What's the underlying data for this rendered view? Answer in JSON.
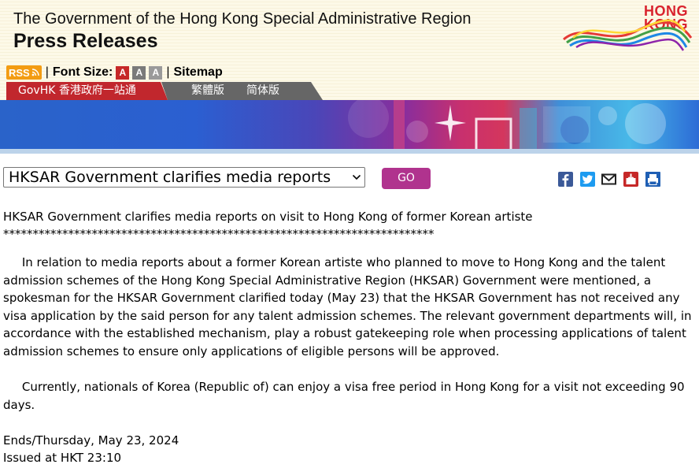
{
  "header": {
    "gov_title": "The Government of the Hong Kong Special Administrative Region",
    "section_title": "Press Releases",
    "brand": {
      "line1": "HONG",
      "line2": "KONG"
    }
  },
  "toolbar": {
    "rss_label": "RSS",
    "separator": "|",
    "font_size_label": "Font Size:",
    "font_sizes": [
      "A",
      "A",
      "A"
    ],
    "sitemap_label": "Sitemap"
  },
  "nav": {
    "govhk": "GovHK 香港政府一站通",
    "traditional": "繁體版",
    "simplified": "简体版"
  },
  "selector": {
    "selected": "HKSAR Government clarifies media reports",
    "go_label": "GO"
  },
  "share_icons": [
    "facebook-icon",
    "twitter-icon",
    "email-icon",
    "bookmark-icon",
    "print-icon"
  ],
  "article": {
    "title": "HKSAR Government clarifies media reports on visit to Hong Kong of former Korean artiste",
    "stars": "*************************************************************************",
    "paragraphs": [
      "In relation to media reports about a former Korean artiste who planned to move to Hong Kong and the talent admission schemes of the Hong Kong Special Administrative Region (HKSAR) Government were mentioned, a spokesman for the HKSAR Government clarified today (May 23) that the HKSAR Government has not received any visa application by the said person for any talent admission schemes. The relevant government departments will, in accordance with the established mechanism, play a robust gatekeeping role when processing applications of talent admission schemes to ensure only applications of eligible persons will be approved.",
      "Currently, nationals of Korea (Republic of) can enjoy a visa free period in Hong Kong for a visit not exceeding 90 days."
    ],
    "ends": "Ends/Thursday, May 23, 2024",
    "issued": "Issued at HKT 23:10"
  },
  "colors": {
    "govhk_red": "#c1272d",
    "go_button": "#b0338e",
    "rss_orange": "#f39c12",
    "brand_red": "#d9232e"
  }
}
